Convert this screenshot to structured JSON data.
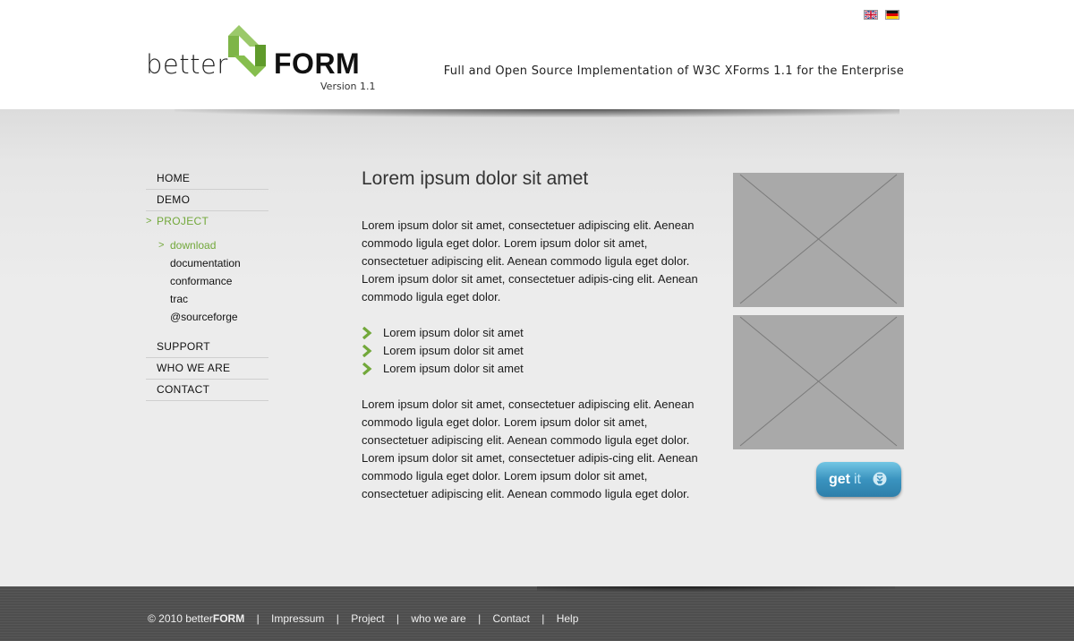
{
  "header": {
    "flags": [
      {
        "name": "english-flag-icon",
        "lang": "en"
      },
      {
        "name": "german-flag-icon",
        "lang": "de"
      }
    ],
    "logo": {
      "word_light": "better",
      "word_bold": "FORM",
      "version": "Version 1.1",
      "accent_color": "#8dc052",
      "accent_dark": "#5f9a2b"
    },
    "tagline": "Full and Open Source Implementation of W3C XForms 1.1 for the Enterprise"
  },
  "nav": {
    "items": [
      {
        "label": "HOME"
      },
      {
        "label": "DEMO"
      },
      {
        "label": "PROJECT",
        "active": true
      },
      {
        "label": "SUPPORT"
      },
      {
        "label": "WHO WE ARE"
      },
      {
        "label": "CONTACT"
      }
    ],
    "project_sub": [
      {
        "label": "download",
        "active": true
      },
      {
        "label": "documentation"
      },
      {
        "label": "conformance"
      },
      {
        "label": "trac"
      },
      {
        "label": "@sourceforge"
      }
    ],
    "active_color": "#72a83a"
  },
  "content": {
    "title": "Lorem ipsum dolor sit amet",
    "paragraph1": "Lorem ipsum dolor sit amet, consectetuer adipiscing elit. Aenean commodo ligula eget dolor. Lorem ipsum dolor sit amet, consectetuer adipiscing elit. Aenean commodo ligula eget dolor. Lorem ipsum dolor sit amet, consectetuer adipis-cing elit. Aenean commodo ligula eget dolor.",
    "bullets": [
      "Lorem ipsum dolor sit amet",
      "Lorem ipsum dolor sit amet",
      "Lorem ipsum dolor sit amet"
    ],
    "paragraph2": "Lorem ipsum dolor sit amet, consectetuer adipiscing elit. Aenean commodo ligula eget dolor. Lorem ipsum dolor sit amet, consectetuer adipiscing elit. Aenean commodo ligula eget dolor. Lorem ipsum dolor sit amet, consectetuer adipis-cing elit. Aenean commodo ligula eget dolor. Lorem ipsum dolor sit amet, consectetuer adipiscing elit. Aenean commodo ligula eget dolor."
  },
  "sidebar": {
    "getit_bold": "get",
    "getit_light": "it",
    "getit_icon": "download-icon"
  },
  "footer": {
    "copyright_prefix": "© 2010 better",
    "copyright_bold": "FORM",
    "links": [
      "Impressum",
      "Project",
      "who we are",
      "Contact",
      "Help"
    ]
  }
}
